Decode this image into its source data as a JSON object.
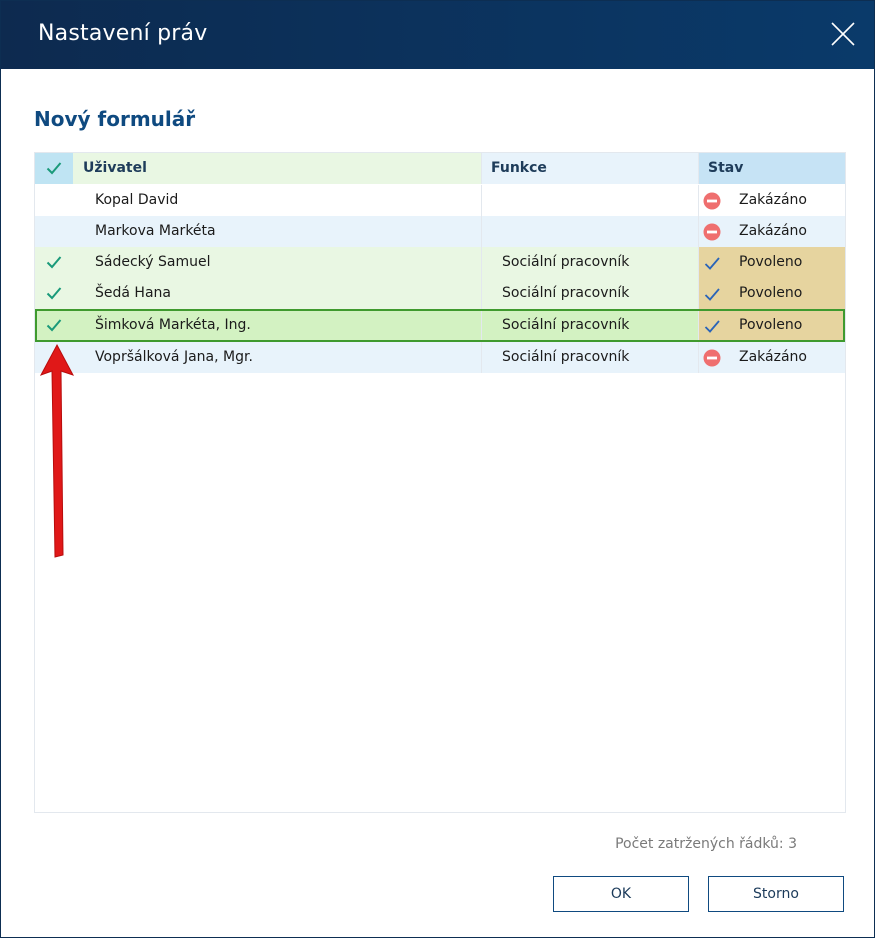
{
  "window": {
    "title": "Nastavení práv"
  },
  "form": {
    "heading": "Nový formulář"
  },
  "table": {
    "columns": {
      "user": "Uživatel",
      "func": "Funkce",
      "stav": "Stav"
    },
    "rows": [
      {
        "user": "Kopal David",
        "func": "",
        "stav": "Zakázáno",
        "checked": false
      },
      {
        "user": "Markova Markéta",
        "func": "",
        "stav": "Zakázáno",
        "checked": false
      },
      {
        "user": "Sádecký Samuel",
        "func": "Sociální pracovník",
        "stav": "Povoleno",
        "checked": true
      },
      {
        "user": "Šedá Hana",
        "func": "Sociální pracovník",
        "stav": "Povoleno",
        "checked": true
      },
      {
        "user": "Šimková Markéta, Ing.",
        "func": "Sociální pracovník",
        "stav": "Povoleno",
        "checked": true
      },
      {
        "user": "Vopršálková Jana, Mgr.",
        "func": "Sociální pracovník",
        "stav": "Zakázáno",
        "checked": false
      }
    ]
  },
  "footer": {
    "count_text": "Počet zatržených řádků: 3",
    "ok_label": "OK",
    "cancel_label": "Storno"
  },
  "colors": {
    "titlebar": "#0d2a4f",
    "accent": "#0f4a80",
    "check": "#1a9a7a",
    "forbidden": "#ef6f6f",
    "allowed_bg": "#e6d49f",
    "arrow": "#e01818"
  },
  "icons": {
    "close": "close-icon",
    "check": "checkmark-icon",
    "forbidden": "no-entry-icon",
    "allowed": "checkmark-icon"
  }
}
